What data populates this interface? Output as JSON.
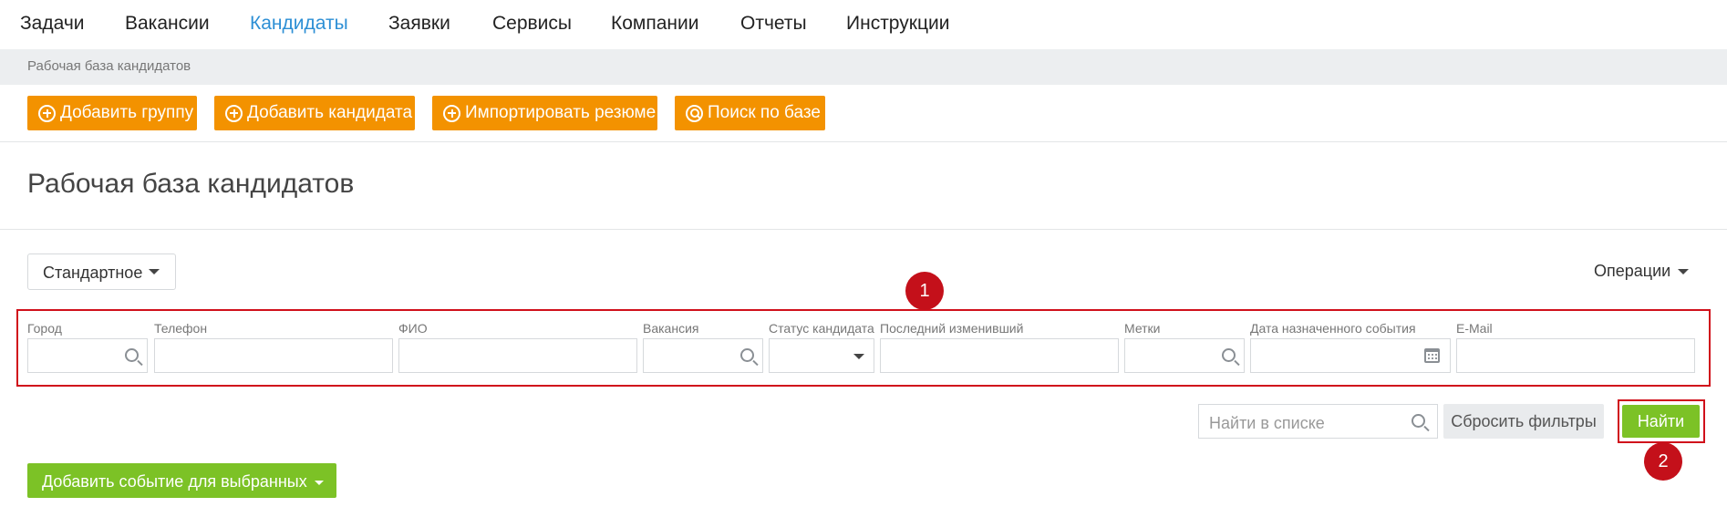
{
  "nav": {
    "items": [
      {
        "label": "Задачи"
      },
      {
        "label": "Вакансии"
      },
      {
        "label": "Кандидаты"
      },
      {
        "label": "Заявки"
      },
      {
        "label": "Сервисы"
      },
      {
        "label": "Компании"
      },
      {
        "label": "Отчеты"
      },
      {
        "label": "Инструкции"
      }
    ],
    "active": "Кандидаты",
    "active_color": "#2d8fd5"
  },
  "breadcrumb": "Рабочая база кандидатов",
  "actions": [
    {
      "label": "Добавить группу",
      "icon": "plus-circle-icon"
    },
    {
      "label": "Добавить кандидата",
      "icon": "plus-circle-icon"
    },
    {
      "label": "Импортировать резюме",
      "icon": "plus-circle-icon"
    },
    {
      "label": "Поиск по базе",
      "icon": "search-circle-icon"
    }
  ],
  "page_title": "Рабочая база кандидатов",
  "view_select": {
    "value": "Стандартное"
  },
  "operations_label": "Операции",
  "filters": [
    {
      "label": "Город",
      "value": "",
      "icon": "search-icon"
    },
    {
      "label": "Телефон",
      "value": ""
    },
    {
      "label": "ФИО",
      "value": ""
    },
    {
      "label": "Вакансия",
      "value": "",
      "icon": "search-icon"
    },
    {
      "label": "Статус кандидата",
      "value": "",
      "icon": "caret-down-icon"
    },
    {
      "label": "Последний изменивший",
      "value": ""
    },
    {
      "label": "Метки",
      "value": "",
      "icon": "search-icon"
    },
    {
      "label": "Дата назначенного события",
      "value": "",
      "icon": "calendar-icon"
    },
    {
      "label": "E-Mail",
      "value": ""
    }
  ],
  "search_list": {
    "placeholder": "Найти в списке"
  },
  "reset_label": "Сбросить фильтры",
  "find_label": "Найти",
  "add_event_label": "Добавить событие для выбранных",
  "annotations": [
    "1",
    "2"
  ],
  "colors": {
    "orange": "#f39200",
    "green": "#7cc226",
    "annotation_red": "#d0101b"
  }
}
